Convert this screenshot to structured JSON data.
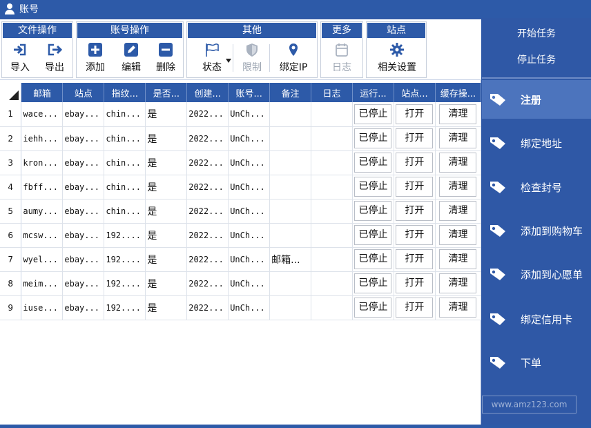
{
  "window": {
    "title": "账号"
  },
  "toolbar": {
    "groups": [
      {
        "title": "文件操作",
        "buttons": [
          "导入",
          "导出"
        ]
      },
      {
        "title": "账号操作",
        "buttons": [
          "添加",
          "编辑",
          "删除"
        ]
      },
      {
        "title": "其他",
        "buttons": [
          "状态",
          "限制",
          "绑定IP"
        ]
      },
      {
        "title": "更多",
        "buttons": [
          "日志"
        ]
      },
      {
        "title": "站点",
        "buttons": [
          "相关设置"
        ]
      }
    ]
  },
  "table": {
    "columns": [
      "邮箱",
      "站点",
      "指纹...",
      "是否...",
      "创建...",
      "账号...",
      "备注",
      "日志",
      "运行...",
      "站点...",
      "缓存操..."
    ],
    "rows": [
      {
        "num": "1",
        "email": "wace...",
        "site": "ebay...",
        "fp": "chin...",
        "flag": "是",
        "created": "2022...",
        "acct": "UnCh...",
        "note": "",
        "log": "",
        "run": "已停止",
        "open": "打开",
        "clear": "清理"
      },
      {
        "num": "2",
        "email": "iehh...",
        "site": "ebay...",
        "fp": "chin...",
        "flag": "是",
        "created": "2022...",
        "acct": "UnCh...",
        "note": "",
        "log": "",
        "run": "已停止",
        "open": "打开",
        "clear": "清理"
      },
      {
        "num": "3",
        "email": "kron...",
        "site": "ebay...",
        "fp": "chin...",
        "flag": "是",
        "created": "2022...",
        "acct": "UnCh...",
        "note": "",
        "log": "",
        "run": "已停止",
        "open": "打开",
        "clear": "清理"
      },
      {
        "num": "4",
        "email": "fbff...",
        "site": "ebay...",
        "fp": "chin...",
        "flag": "是",
        "created": "2022...",
        "acct": "UnCh...",
        "note": "",
        "log": "",
        "run": "已停止",
        "open": "打开",
        "clear": "清理"
      },
      {
        "num": "5",
        "email": "aumy...",
        "site": "ebay...",
        "fp": "chin...",
        "flag": "是",
        "created": "2022...",
        "acct": "UnCh...",
        "note": "",
        "log": "",
        "run": "已停止",
        "open": "打开",
        "clear": "清理"
      },
      {
        "num": "6",
        "email": "mcsw...",
        "site": "ebay...",
        "fp": "192....",
        "flag": "是",
        "created": "2022...",
        "acct": "UnCh...",
        "note": "",
        "log": "",
        "run": "已停止",
        "open": "打开",
        "clear": "清理"
      },
      {
        "num": "7",
        "email": "wyel...",
        "site": "ebay...",
        "fp": "192....",
        "flag": "是",
        "created": "2022...",
        "acct": "UnCh...",
        "note": "邮箱...",
        "log": "",
        "run": "已停止",
        "open": "打开",
        "clear": "清理"
      },
      {
        "num": "8",
        "email": "meim...",
        "site": "ebay...",
        "fp": "192....",
        "flag": "是",
        "created": "2022...",
        "acct": "UnCh...",
        "note": "",
        "log": "",
        "run": "已停止",
        "open": "打开",
        "clear": "清理"
      },
      {
        "num": "9",
        "email": "iuse...",
        "site": "ebay...",
        "fp": "192....",
        "flag": "是",
        "created": "2022...",
        "acct": "UnCh...",
        "note": "",
        "log": "",
        "run": "已停止",
        "open": "打开",
        "clear": "清理"
      }
    ]
  },
  "side": {
    "start_task": "开始任务",
    "stop_task": "停止任务",
    "nav": [
      "注册",
      "绑定地址",
      "检查封号",
      "添加到购物车",
      "添加到心愿单",
      "绑定信用卡",
      "下单"
    ],
    "active_index": 0,
    "watermark": "www.amz123.com"
  },
  "colors": {
    "primary": "#2d5aa8",
    "active_nav": "#4c74bd",
    "disabled": "#9aa3b0"
  }
}
